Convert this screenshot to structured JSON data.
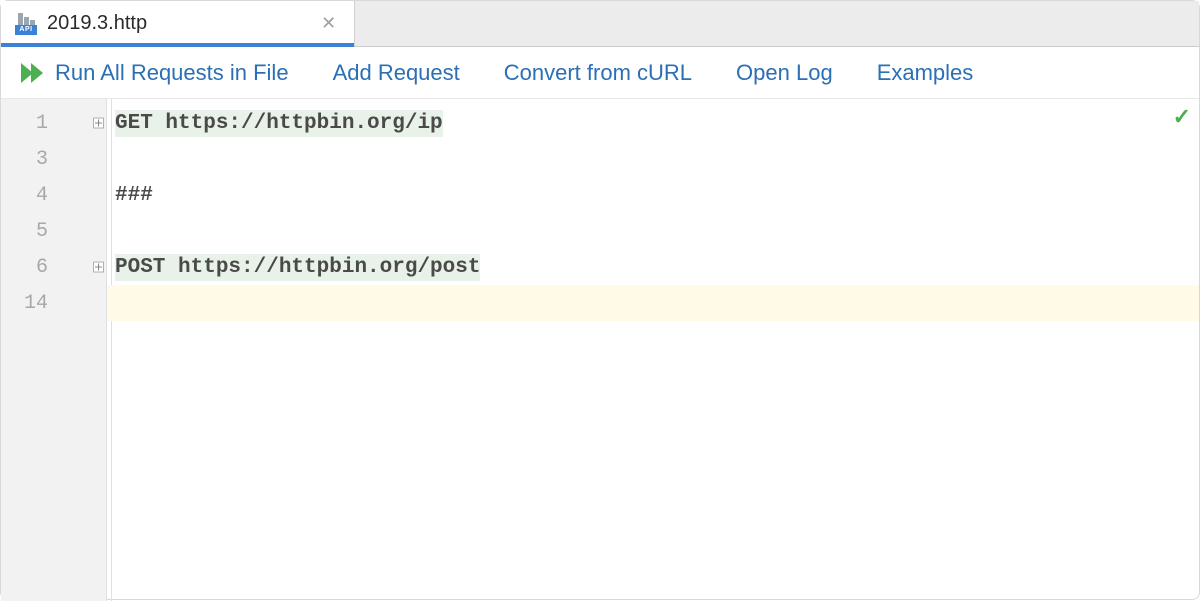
{
  "tab": {
    "filename": "2019.3.http",
    "iconBadge": "API"
  },
  "actions": {
    "runAll": "Run All Requests in File",
    "addRequest": "Add Request",
    "convertCurl": "Convert from cURL",
    "openLog": "Open Log",
    "examples": "Examples"
  },
  "gutter": {
    "lines": [
      {
        "num": "1",
        "fold": true
      },
      {
        "num": "3",
        "fold": false
      },
      {
        "num": "4",
        "fold": false
      },
      {
        "num": "5",
        "fold": false
      },
      {
        "num": "6",
        "fold": true
      },
      {
        "num": "14",
        "fold": false
      }
    ]
  },
  "code": {
    "lines": [
      {
        "text": "GET https://httpbin.org/ip",
        "highlight": true,
        "current": false
      },
      {
        "text": "",
        "highlight": false,
        "current": false
      },
      {
        "text": "###",
        "highlight": false,
        "current": false
      },
      {
        "text": "",
        "highlight": false,
        "current": false
      },
      {
        "text": "POST https://httpbin.org/post",
        "highlight": true,
        "current": false
      },
      {
        "text": "",
        "highlight": false,
        "current": true
      }
    ]
  },
  "analysis": {
    "ok": "✓"
  }
}
